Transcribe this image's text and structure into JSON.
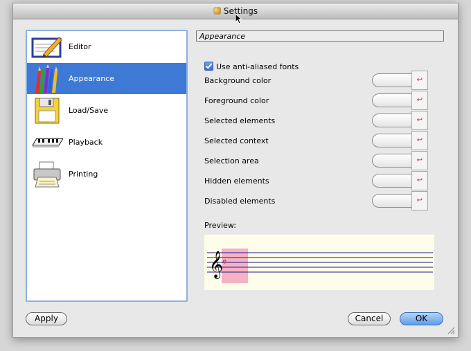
{
  "window": {
    "title": "Settings"
  },
  "sidebar": {
    "items": [
      {
        "label": "Editor",
        "icon": "editor-pencil-icon"
      },
      {
        "label": "Appearance",
        "icon": "colored-pencils-icon",
        "selected": true
      },
      {
        "label": "Load/Save",
        "icon": "floppy-disk-icon"
      },
      {
        "label": "Playback",
        "icon": "keyboard-icon"
      },
      {
        "label": "Printing",
        "icon": "printer-icon"
      }
    ]
  },
  "panel": {
    "title": "Appearance",
    "antialias": {
      "label": "Use anti-aliased fonts",
      "checked": true
    },
    "color_rows": [
      "Background color",
      "Foreground color",
      "Selected elements",
      "Selected context",
      "Selection area",
      "Hidden elements",
      "Disabled elements"
    ],
    "preview_label": "Preview:"
  },
  "colors": {
    "accent": "#3f79d6",
    "preview_bg": "#fdfde9",
    "selection": "#f7b0c4",
    "staff": "#1a1a8a",
    "note": "#e02020"
  },
  "buttons": {
    "apply": "Apply",
    "cancel": "Cancel",
    "ok": "OK"
  }
}
